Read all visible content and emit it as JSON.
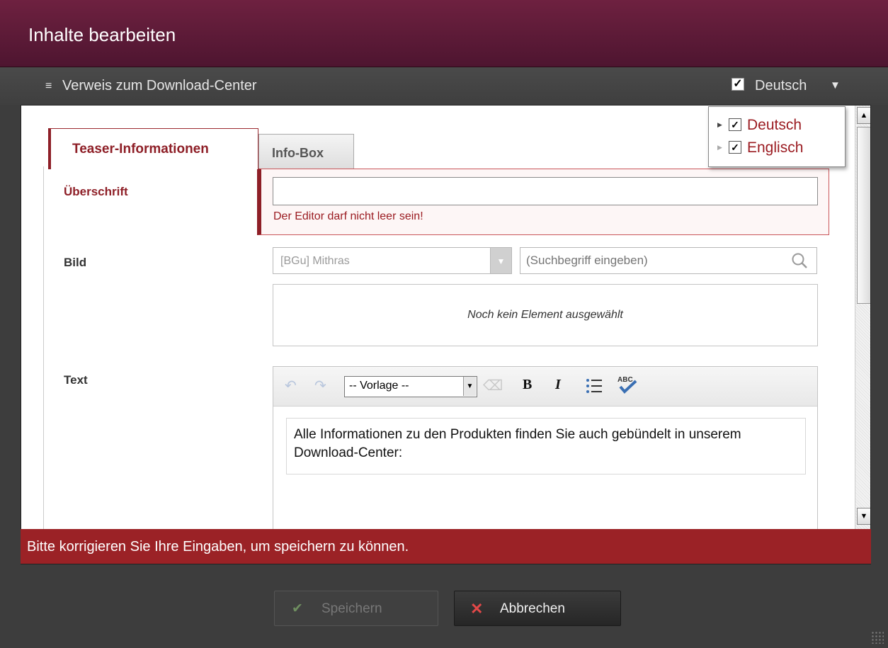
{
  "dialog": {
    "title": "Inhalte bearbeiten"
  },
  "subbar": {
    "menu_icon": "≡",
    "item_title": "Verweis zum Download-Center",
    "language_label": "Deutsch",
    "language_checked": "✓",
    "caret": "▼"
  },
  "language_popup": {
    "items": [
      {
        "label": "Deutsch",
        "checked": "✓"
      },
      {
        "label": "Englisch",
        "checked": "✓"
      }
    ]
  },
  "tabs": [
    {
      "label": "Teaser-Informationen"
    },
    {
      "label": "Info-Box"
    }
  ],
  "form": {
    "headline": {
      "label": "Überschrift",
      "value": "",
      "error": "Der Editor darf nicht leer sein!"
    },
    "image": {
      "label": "Bild",
      "source_select": "[BGu] Mithras",
      "search_placeholder": "(Suchbegriff eingeben)",
      "empty_text": "Noch kein Element ausgewählt"
    },
    "text": {
      "label": "Text",
      "style_select": "-- Vorlage --",
      "bold": "B",
      "italic": "I",
      "content": "Alle Informationen zu den Produkten finden Sie auch gebündelt in unserem Download-Center:"
    }
  },
  "error_banner": "Bitte korrigieren Sie Ihre Eingaben, um speichern zu können.",
  "buttons": {
    "save": "Speichern",
    "cancel": "Abbrechen"
  },
  "colors": {
    "brand": "#6e2140",
    "error": "#9b2226",
    "accent_text": "#8e1f27"
  },
  "icons": [
    "menu-icon",
    "checkbox-icon",
    "caret-down-icon",
    "search-icon",
    "undo-icon",
    "redo-icon",
    "eraser-icon",
    "bold-icon",
    "italic-icon",
    "list-icon",
    "spellcheck-icon",
    "check-icon",
    "close-icon",
    "resize-grip-icon"
  ]
}
